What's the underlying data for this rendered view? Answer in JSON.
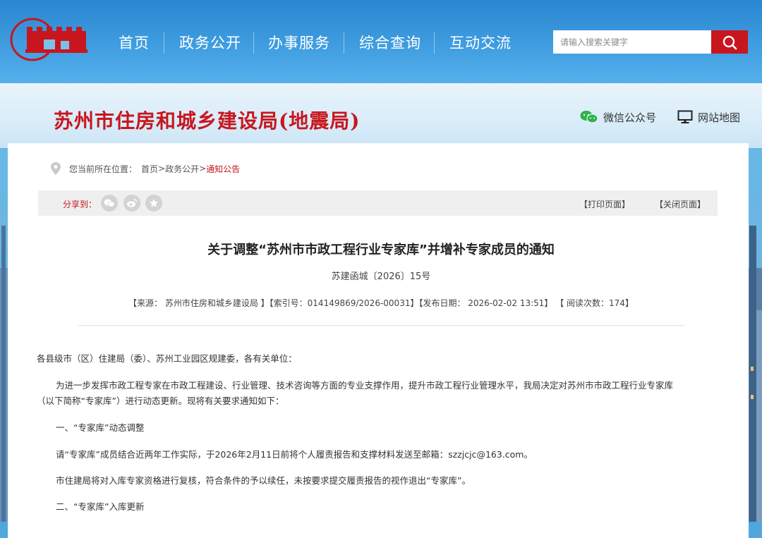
{
  "nav": {
    "items": [
      "首页",
      "政务公开",
      "办事服务",
      "综合查询",
      "互动交流"
    ],
    "search_placeholder": "请输入搜索关键字"
  },
  "header": {
    "site_title": "苏州市住房和城乡建设局(地震局)",
    "wechat_label": "微信公众号",
    "sitemap_label": "网站地图"
  },
  "breadcrumb": {
    "prefix": "您当前所在位置：",
    "home": "首页",
    "sep1": ">",
    "section": "政务公开",
    "sep2": ">",
    "current": "通知公告"
  },
  "share": {
    "label": "分享到：",
    "icons": [
      "wechat-icon",
      "weibo-icon",
      "favorite-icon"
    ],
    "print_label": "【打印页面】",
    "close_label": "【关闭页面】"
  },
  "article": {
    "title": "关于调整“苏州市市政工程行业专家库”并增补专家成员的通知",
    "doc_number": "苏建函城〔2026〕15号",
    "meta": "【来源： 苏州市住房和城乡建设局 】【索引号：014149869/2026-00031】【发布日期： 2026-02-02 13:51】 【 阅读次数：174】",
    "paragraphs": [
      "各县级市（区）住建局（委）、苏州工业园区规建委，各有关单位：",
      "为进一步发挥市政工程专家在市政工程建设、行业管理、技术咨询等方面的专业支撑作用，提升市政工程行业管理水平，我局决定对苏州市市政工程行业专家库",
      "（以下简称“专家库”）进行动态更新。现将有关要求通知如下：",
      "一、“专家库”动态调整",
      "请“专家库”成员结合近两年工作实际，于2026年2月11日前将个人履责报告和支撑材料发送至邮箱：szzjcjc@163.com。",
      "市住建局将对入库专家资格进行复核，符合条件的予以续任，未按要求提交履责报告的视作退出“专家库”。",
      "二、“专家库”入库更新"
    ]
  },
  "colors": {
    "brand_red": "#c8161e",
    "nav_blue": "#3f9de0"
  }
}
